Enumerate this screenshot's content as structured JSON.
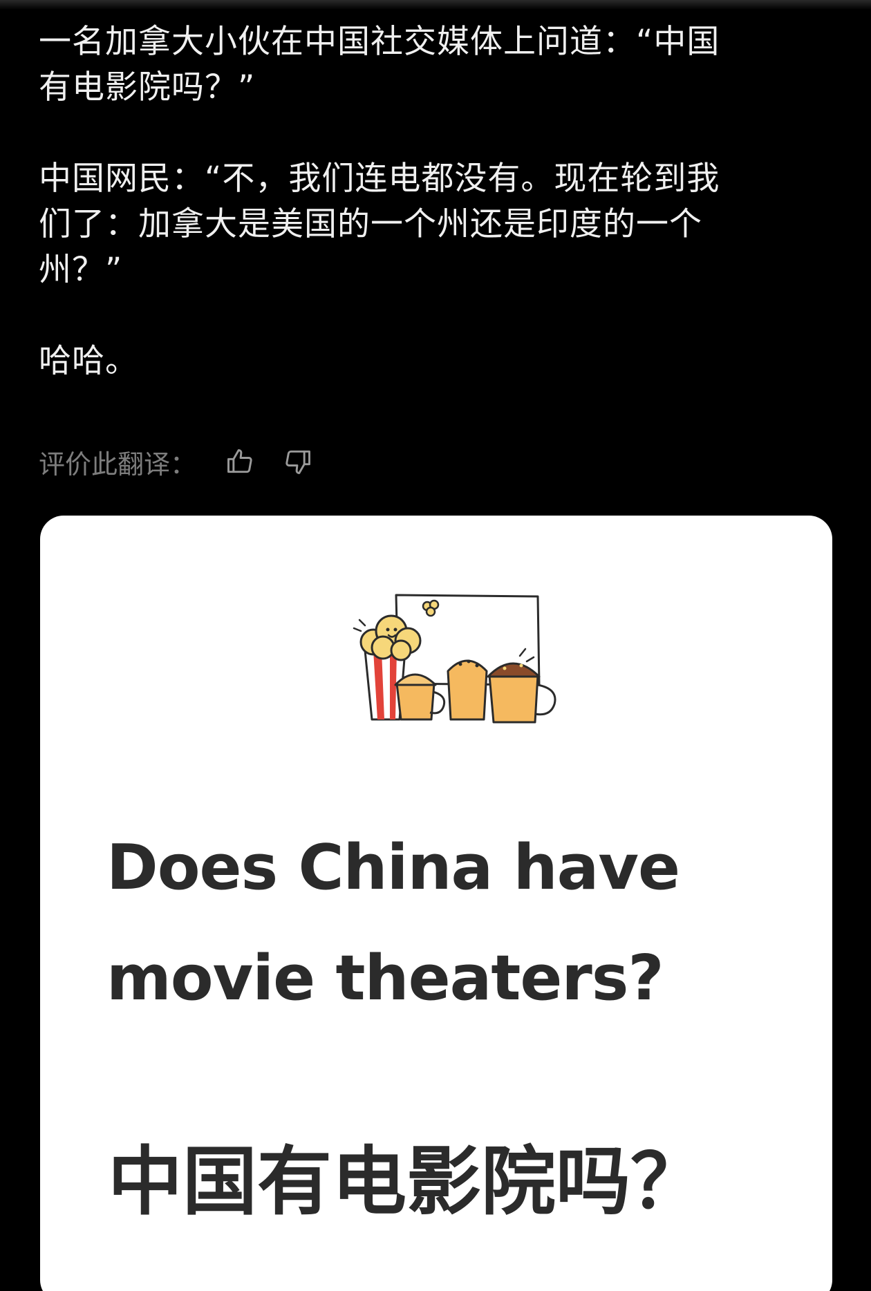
{
  "post": {
    "paragraph_1_line_1": "一名加拿大小伙在中国社交媒体上问道：“中国",
    "paragraph_1_line_2": "有电影院吗？”",
    "paragraph_2_line_1": "中国网民：“不，我们连电都没有。现在轮到我",
    "paragraph_2_line_2": "们了：加拿大是美国的一个州还是印度的一个",
    "paragraph_2_line_3": "州？”",
    "paragraph_3": "哈哈。"
  },
  "translation_rating": {
    "label": "评价此翻译：",
    "thumbs_up_icon": "thumbs-up-icon",
    "thumbs_down_icon": "thumbs-down-icon"
  },
  "card": {
    "illustration_icon": "popcorn-and-cups-illustration",
    "title_en_line_1": "Does China have",
    "title_en_line_2": "movie theaters?",
    "title_zh": "中国有电影院吗？"
  },
  "colors": {
    "background": "#000000",
    "text": "#f0f0f0",
    "muted": "#7d7d7d",
    "card_background": "#ffffff",
    "card_text": "#2b2b2b",
    "popcorn": "#f6d77a",
    "stripe_red": "#e2433a",
    "cup_orange": "#f5b95f"
  }
}
